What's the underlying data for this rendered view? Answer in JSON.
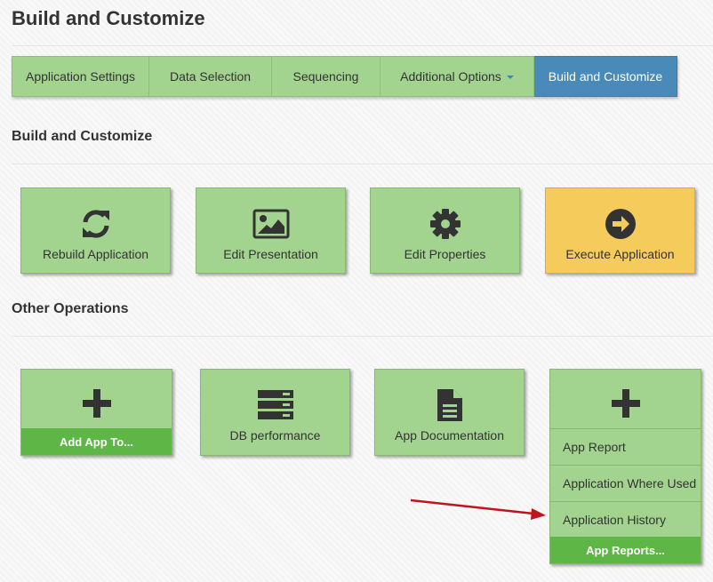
{
  "page": {
    "title": "Build and Customize"
  },
  "tabs": [
    {
      "label": "Application Settings"
    },
    {
      "label": "Data Selection"
    },
    {
      "label": "Sequencing"
    },
    {
      "label": "Additional Options"
    },
    {
      "label": "Build and Customize"
    }
  ],
  "active_tab": "Build and Customize",
  "build_section": {
    "title": "Build and Customize",
    "tiles": [
      {
        "label": "Rebuild Application",
        "icon": "refresh-icon"
      },
      {
        "label": "Edit Presentation",
        "icon": "image-icon"
      },
      {
        "label": "Edit Properties",
        "icon": "gear-icon"
      },
      {
        "label": "Execute Application",
        "icon": "arrow-right-circle-icon"
      }
    ]
  },
  "other_section": {
    "title": "Other Operations",
    "add_app": {
      "icon": "plus-icon",
      "footer": "Add App To..."
    },
    "db_performance": {
      "label": "DB performance",
      "icon": "server-icon"
    },
    "app_documentation": {
      "label": "App Documentation",
      "icon": "document-icon"
    },
    "app_reports": {
      "icon": "plus-icon",
      "menu": [
        "App Report",
        "Application Where Used",
        "Application History"
      ],
      "footer": "App Reports..."
    }
  },
  "colors": {
    "tile_green": "#a2d490",
    "tile_yellow": "#f5cb5c",
    "tab_active": "#4a8ab9",
    "footer_green": "#5db645",
    "annotation_arrow": "#c0141c"
  }
}
